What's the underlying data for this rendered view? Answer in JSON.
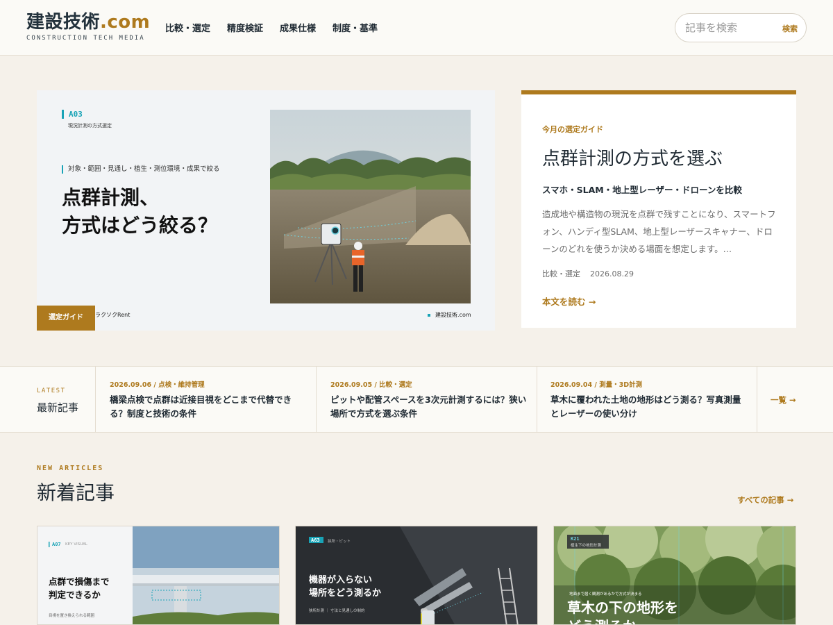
{
  "header": {
    "logo_main": "建設技術",
    "logo_accent": ".com",
    "logo_sub": "CONSTRUCTION TECH MEDIA",
    "nav": [
      "比較・選定",
      "精度検証",
      "成果仕様",
      "制度・基準"
    ],
    "search_placeholder": "記事を検索",
    "search_button": "検索"
  },
  "hero": {
    "visual": {
      "code": "A03",
      "code_sub": "現況計測の方式選定",
      "tagline": "対象・範囲・見通し・植生・測位環境・成果で絞る",
      "headline": "点群計測、\n方式はどう絞る？",
      "badge": "選定ガイド",
      "brand_left": "ラクソクRent",
      "brand_right": "建設技術.com"
    },
    "card": {
      "eyebrow": "今月の選定ガイド",
      "title": "点群計測の方式を選ぶ",
      "subtitle": "スマホ・SLAM・地上型レーザー・ドローンを比較",
      "body": "造成地や構造物の現況を点群で残すことになり、スマートフォン、ハンディ型SLAM、地上型レーザースキャナー、ドローンのどれを使うか決める場面を想定します。…",
      "category": "比較・選定",
      "date": "2026.08.29",
      "read_more": "本文を読む →"
    }
  },
  "latest": {
    "eyebrow": "LATEST",
    "title": "最新記事",
    "items": [
      {
        "meta": "2026.09.06 / 点検・維持管理",
        "title": "橋梁点検で点群は近接目視をどこまで代替できる？制度と技術の条件"
      },
      {
        "meta": "2026.09.05 / 比較・選定",
        "title": "ピットや配管スペースを3次元計測するには？狭い場所で方式を選ぶ条件"
      },
      {
        "meta": "2026.09.04 / 測量・3D計測",
        "title": "草木に覆われた土地の地形はどう測る？写真測量とレーザーの使い分け"
      }
    ],
    "more": "一覧 →"
  },
  "new_articles": {
    "eyebrow": "NEW ARTICLES",
    "title": "新着記事",
    "all_link": "すべての記事 →",
    "cards": [
      {
        "code": "A07",
        "code_sub": "KEY VISUAL",
        "title": "点群で損傷まで\n判定できるか",
        "foot": "目視を置き換えられる範囲"
      },
      {
        "code": "A63",
        "code_sub": "狭所・ピット",
        "title": "機器が入らない\n場所をどう測るか",
        "foot": "狭所計測 ｜ 寸法と見通しの制約"
      },
      {
        "code": "K21",
        "code_sub": "植生下の地形計測",
        "title": "草木の下の地形を\nどう測るか",
        "foot": "地面まで届く観測があるかで方式が決まる"
      }
    ]
  },
  "colors": {
    "accent": "#ae7a1e",
    "teal": "#19a3b6",
    "background": "#f5f1ea",
    "ink": "#1f2a33"
  }
}
